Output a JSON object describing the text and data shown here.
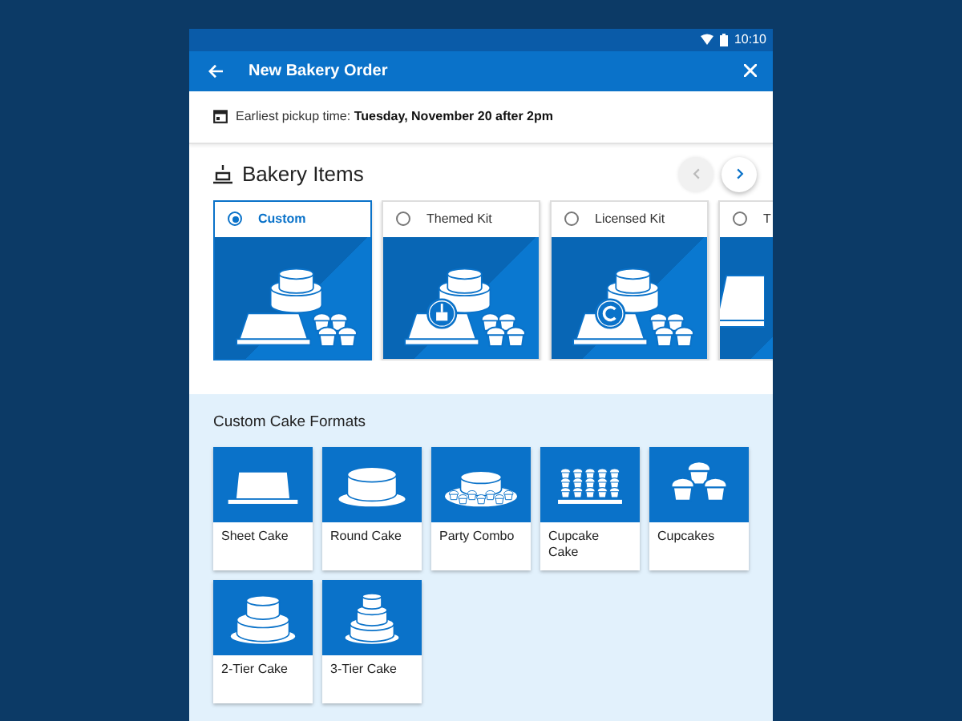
{
  "status_bar": {
    "time": "10:10"
  },
  "app_bar": {
    "title": "New Bakery Order"
  },
  "pickup": {
    "label": "Earliest pickup time: ",
    "value": "Tuesday, November 20 after 2pm"
  },
  "bakery_items": {
    "title": "Bakery Items",
    "nav": [
      {
        "kind": "prev",
        "disabled": true
      },
      {
        "kind": "next",
        "disabled": false
      }
    ],
    "items": [
      {
        "label": "Custom",
        "selected": true,
        "kind": "plain"
      },
      {
        "label": "Themed Kit",
        "selected": false,
        "kind": "brush"
      },
      {
        "label": "Licensed Kit",
        "selected": false,
        "kind": "copyright"
      },
      {
        "label": "T",
        "selected": false,
        "kind": "partial"
      }
    ]
  },
  "formats": {
    "title": "Custom Cake Formats",
    "items": [
      {
        "label": "Sheet Cake",
        "kind": "sheet"
      },
      {
        "label": "Round Cake",
        "kind": "round"
      },
      {
        "label": "Party Combo",
        "kind": "party"
      },
      {
        "label": "Cupcake Cake",
        "kind": "cupcake-cake"
      },
      {
        "label": "Cupcakes",
        "kind": "cupcakes"
      },
      {
        "label": "2-Tier Cake",
        "kind": "tier2"
      },
      {
        "label": "3-Tier Cake",
        "kind": "tier3"
      }
    ]
  }
}
